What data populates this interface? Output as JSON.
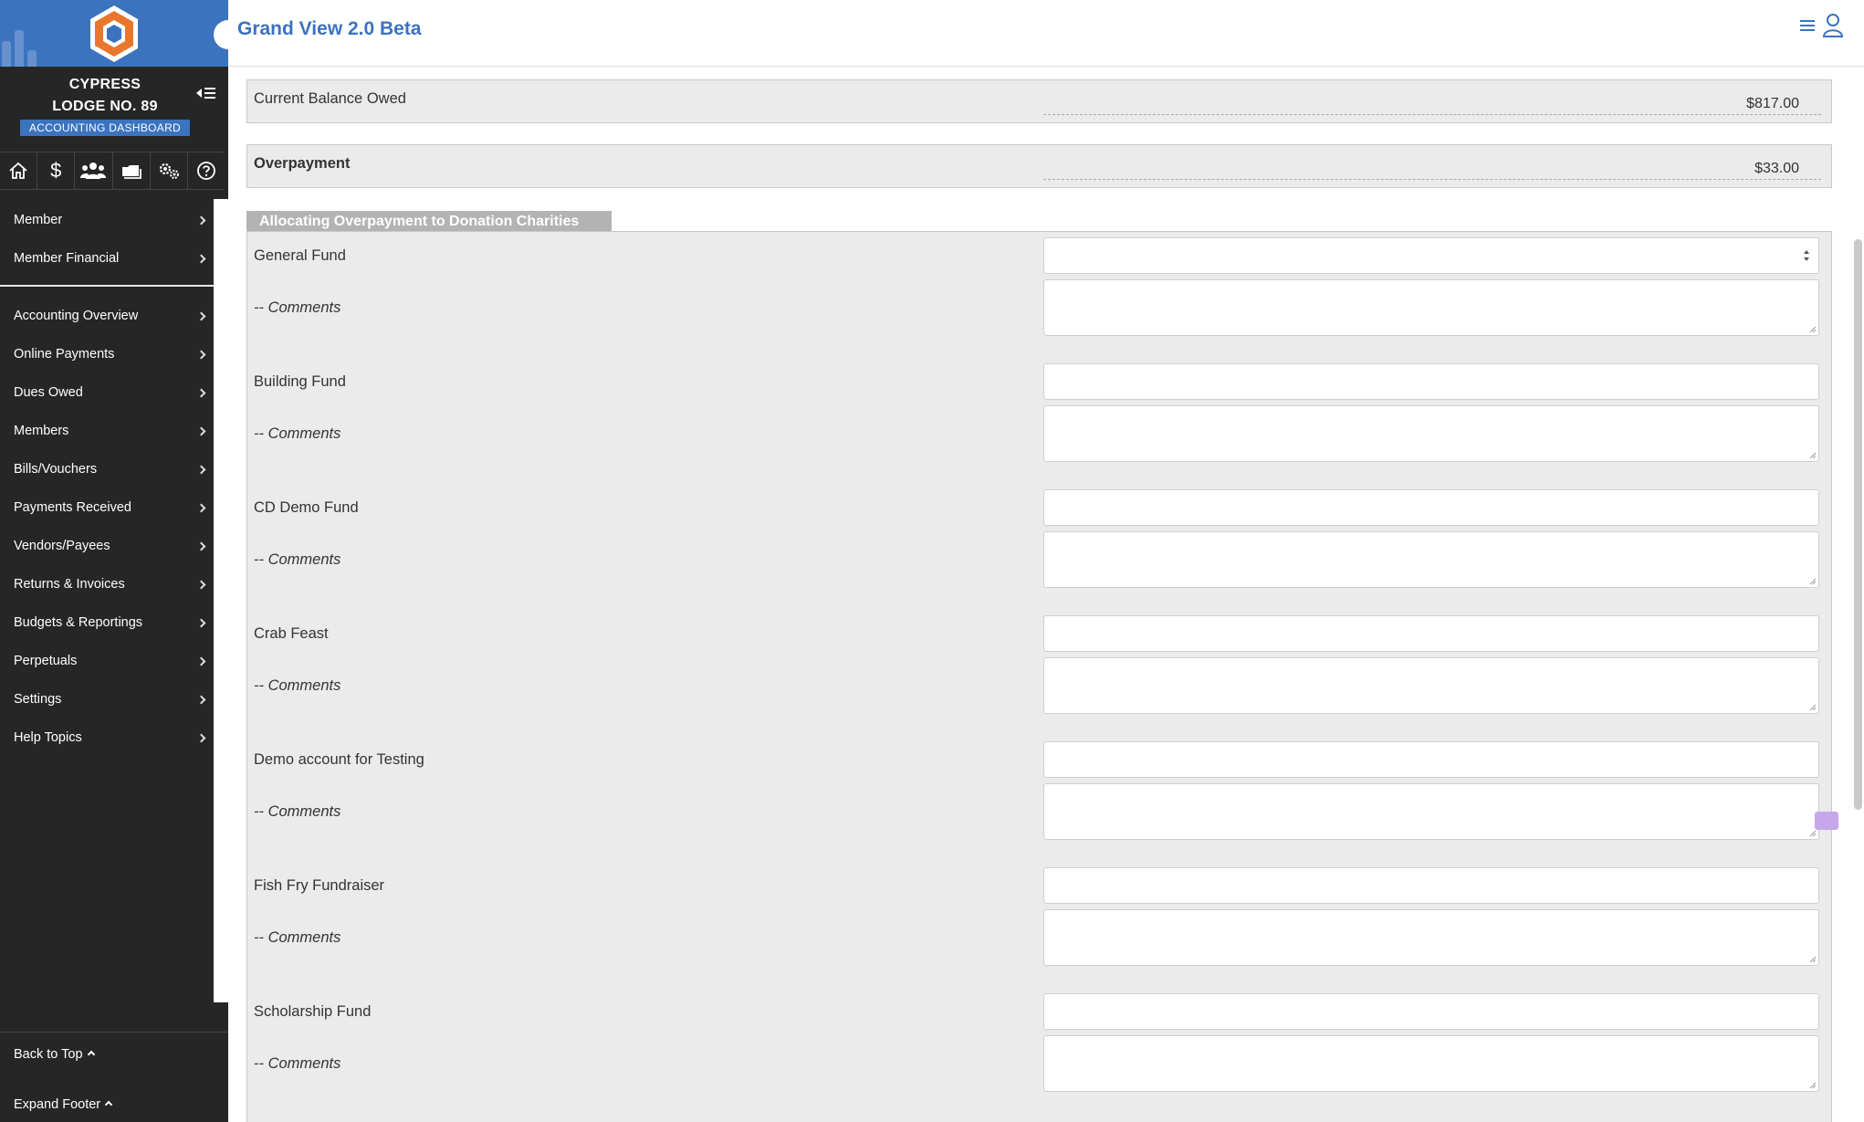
{
  "app": {
    "title": "Grand View 2.0 Beta"
  },
  "org": {
    "name_line1": "CYPRESS",
    "name_line2": "LODGE NO. 89",
    "dashboard_badge": "ACCOUNTING DASHBOARD"
  },
  "icon_row": [
    {
      "icon": "home-icon"
    },
    {
      "icon": "dollar-icon"
    },
    {
      "icon": "users-icon"
    },
    {
      "icon": "folder-icon"
    },
    {
      "icon": "gears-icon"
    },
    {
      "icon": "help-icon"
    }
  ],
  "nav_top": [
    {
      "label": "Member"
    },
    {
      "label": "Member Financial"
    }
  ],
  "nav_main": [
    {
      "label": "Accounting Overview"
    },
    {
      "label": "Online Payments"
    },
    {
      "label": "Dues Owed"
    },
    {
      "label": "Members"
    },
    {
      "label": "Bills/Vouchers"
    },
    {
      "label": "Payments Received"
    },
    {
      "label": "Vendors/Payees"
    },
    {
      "label": "Returns & Invoices"
    },
    {
      "label": "Budgets & Reportings"
    },
    {
      "label": "Perpetuals"
    },
    {
      "label": "Settings"
    },
    {
      "label": "Help Topics"
    }
  ],
  "footer": {
    "back_to_top": "Back to Top",
    "expand_footer": "Expand Footer"
  },
  "summary": {
    "balance_label": "Current Balance Owed",
    "balance_value": "$817.00",
    "overpayment_label": "Overpayment",
    "overpayment_value": "$33.00"
  },
  "allocation": {
    "section_title": "Allocating Overpayment to Donation Charities",
    "comment_label": "-- Comments",
    "funds": [
      {
        "name": "General Fund",
        "value": "",
        "comment": ""
      },
      {
        "name": "Building Fund",
        "value": "",
        "comment": ""
      },
      {
        "name": "CD Demo Fund",
        "value": "",
        "comment": ""
      },
      {
        "name": "Crab Feast",
        "value": "",
        "comment": ""
      },
      {
        "name": "Demo account for Testing",
        "value": "",
        "comment": ""
      },
      {
        "name": "Fish Fry Fundraiser",
        "value": "",
        "comment": ""
      },
      {
        "name": "Scholarship Fund",
        "value": "",
        "comment": ""
      }
    ]
  },
  "colors": {
    "brand_blue": "#3b73bf",
    "sidebar_bg": "#262626",
    "logo_orange": "#e8762d"
  }
}
